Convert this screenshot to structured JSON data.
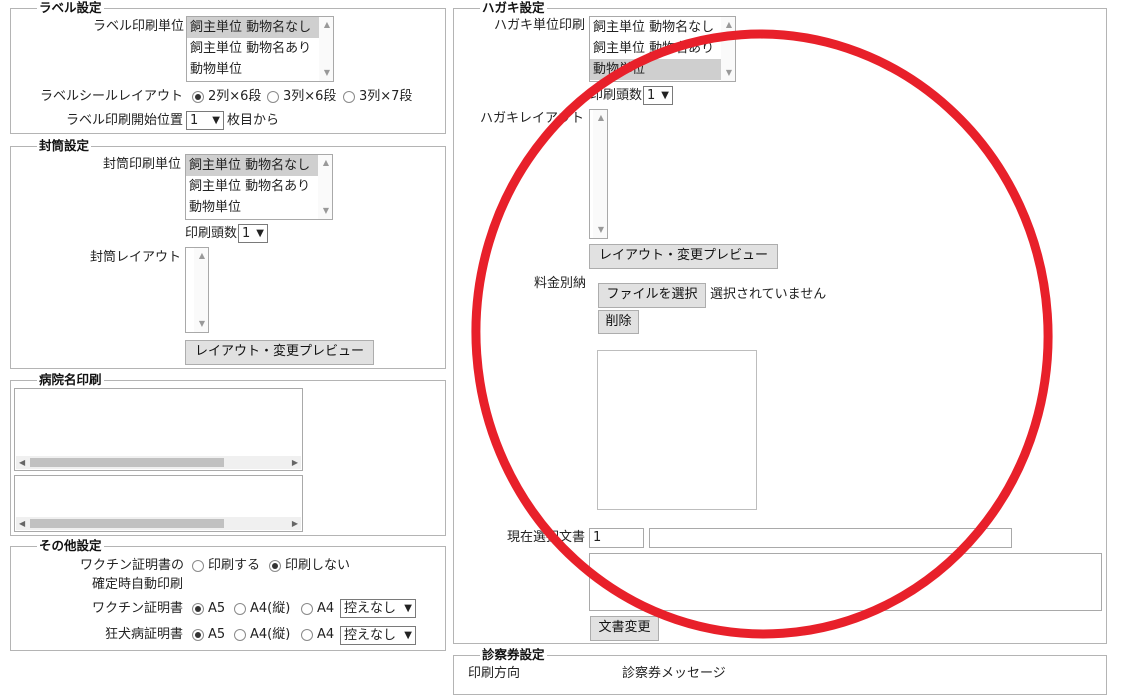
{
  "label_section": {
    "legend": "ラベル設定",
    "print_unit_label": "ラベル印刷単位",
    "print_unit_options": [
      "飼主単位 動物名なし",
      "飼主単位 動物名あり",
      "動物単位"
    ],
    "layout_label": "ラベルシールレイアウト",
    "layout_options": [
      "2列×6段",
      "3列×6段",
      "3列×7段"
    ],
    "start_pos_label": "ラベル印刷開始位置",
    "start_pos_value": "1",
    "start_pos_suffix": "枚目から"
  },
  "envelope_section": {
    "legend": "封筒設定",
    "print_unit_label": "封筒印刷単位",
    "print_unit_options": [
      "飼主単位 動物名なし",
      "飼主単位 動物名あり",
      "動物単位"
    ],
    "copies_label": "印刷頭数",
    "copies_value": "1",
    "layout_label": "封筒レイアウト",
    "preview_button": "レイアウト・変更プレビュー"
  },
  "hospital_section": {
    "legend": "病院名印刷"
  },
  "other_section": {
    "legend": "その他設定",
    "vaccine_auto_label_1": "ワクチン証明書の",
    "vaccine_auto_label_2": "確定時自動印刷",
    "print_yes": "印刷する",
    "print_no": "印刷しない",
    "vaccine_cert_label": "ワクチン証明書",
    "rabies_cert_label": "狂犬病証明書",
    "paper_options": [
      "A5",
      "A4(縦)",
      "A4"
    ],
    "copy_select": "控えなし"
  },
  "postcard_section": {
    "legend": "ハガキ設定",
    "print_unit_label": "ハガキ単位印刷",
    "print_unit_options": [
      "飼主単位 動物名なし",
      "飼主単位 動物名あり",
      "動物単位"
    ],
    "copies_label": "印刷頭数",
    "copies_value": "1",
    "layout_label": "ハガキレイアウト",
    "preview_button": "レイアウト・変更プレビュー",
    "postage_label": "料金別納",
    "file_button": "ファイルを選択",
    "file_status": "選択されていません",
    "delete_button": "削除",
    "doc_label": "現在選択文書",
    "doc_number": "1",
    "doc_change_button": "文書変更"
  },
  "exam_section": {
    "legend": "診察券設定",
    "direction_label": "印刷方向",
    "message_label": "診察券メッセージ"
  },
  "colors": {
    "annotation_circle": "#e8202a"
  }
}
